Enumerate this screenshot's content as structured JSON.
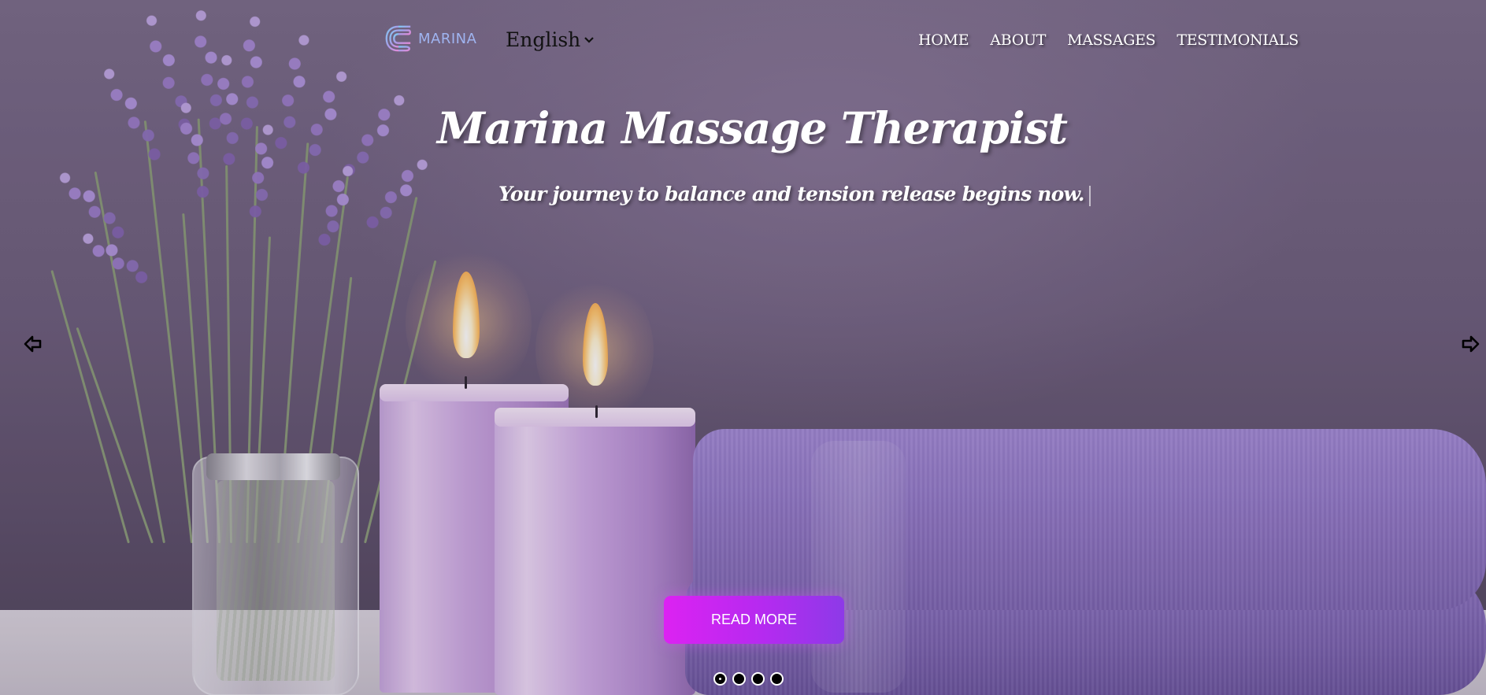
{
  "header": {
    "logo_text": "MARINA",
    "language": {
      "selected": "English"
    },
    "nav": [
      {
        "label": "HOME"
      },
      {
        "label": "ABOUT"
      },
      {
        "label": "MASSAGES"
      },
      {
        "label": "TESTIMONIALS"
      }
    ]
  },
  "hero": {
    "title": "Marina Massage Therapist",
    "subtitle": "Your journey to balance and tension release begins now.",
    "cta_label": "READ MORE",
    "background_icon": "lavender-candles-towels-image"
  },
  "carousel": {
    "slide_count": 4,
    "active_index": 0,
    "prev_icon": "arrow-left-icon",
    "next_icon": "arrow-right-icon"
  },
  "colors": {
    "cta_gradient_start": "#dc22f2",
    "cta_gradient_end": "#8d3ae8",
    "logo_accent": "#9fb4f0"
  }
}
